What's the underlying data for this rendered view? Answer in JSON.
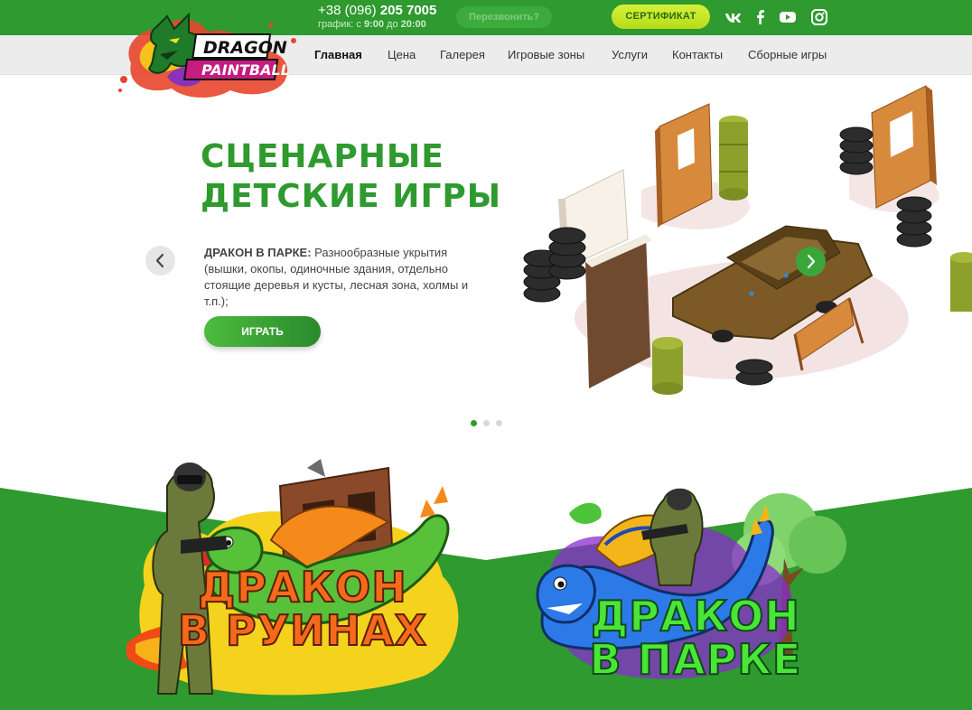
{
  "topbar": {
    "phone_prefix": "+38 (096) ",
    "phone_number": "205 7005",
    "schedule_prefix": "график: с ",
    "schedule_from": "9:00",
    "schedule_mid": " до ",
    "schedule_to": "20:00",
    "callback_label": "Перезвонить?",
    "certificate_label": "СЕРТИФИКАТ",
    "social_icons": [
      "vk-icon",
      "facebook-icon",
      "youtube-icon",
      "instagram-icon"
    ]
  },
  "logo": {
    "line1": "DRAGON",
    "line2": "PAINTBALL"
  },
  "nav": {
    "items": [
      {
        "label": "Главная",
        "active": true
      },
      {
        "label": "Цена"
      },
      {
        "label": "Галерея"
      },
      {
        "label": "Игровые зоны"
      },
      {
        "label": "Услуги"
      },
      {
        "label": "Контакты"
      },
      {
        "label": "Сборные игры"
      }
    ]
  },
  "hero": {
    "title_line1": "СЦЕНАРНЫЕ",
    "title_line2": "ДЕТСКИЕ ИГРЫ",
    "desc_bold": "ДРАКОН В ПАРКЕ:",
    "desc_text": " Разнообразные укрытия (вышки, окопы, одиночные здания, отдельно стоящие деревья и кусты, лесная зона, холмы и т.п.);",
    "play_label": "ИГРАТЬ",
    "slide_count": 3,
    "active_slide": 1
  },
  "cards": [
    {
      "line1": "ДРАКОН",
      "line2": "В РУИНАХ"
    },
    {
      "line1": "ДРАКОН",
      "line2": "В ПАРКЕ"
    }
  ],
  "colors": {
    "brand_green": "#2e9a2f",
    "accent_lime": "#c8e62a",
    "orange": "#f56a1a"
  }
}
